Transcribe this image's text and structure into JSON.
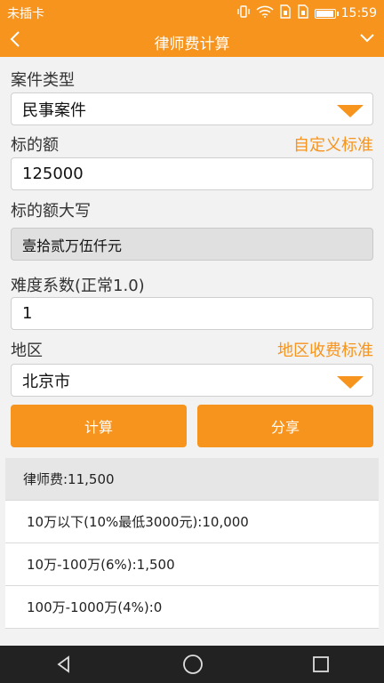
{
  "status_bar": {
    "carrier": "未插卡",
    "time": "15:59",
    "battery_level": 0.9
  },
  "app_bar": {
    "title": "律师费计算"
  },
  "form": {
    "case_type_label": "案件类型",
    "case_type_value": "民事案件",
    "amount_label": "标的额",
    "custom_standard_link": "自定义标准",
    "amount_value": "125000",
    "amount_uppercase_label": "标的额大写",
    "amount_uppercase_value": "壹拾贰万伍仟元",
    "difficulty_label": "难度系数(正常1.0)",
    "difficulty_value": "1",
    "region_label": "地区",
    "region_standard_link": "地区收费标准",
    "region_value": "北京市"
  },
  "actions": {
    "calculate_label": "计算",
    "share_label": "分享"
  },
  "results": {
    "total": "律师费:11,500",
    "items": [
      "10万以下(10%最低3000元):10,000",
      "10万-100万(6%):1,500",
      "100万-1000万(4%):0"
    ]
  },
  "colors": {
    "accent": "#f7941d",
    "nav_bar": "#222222"
  }
}
